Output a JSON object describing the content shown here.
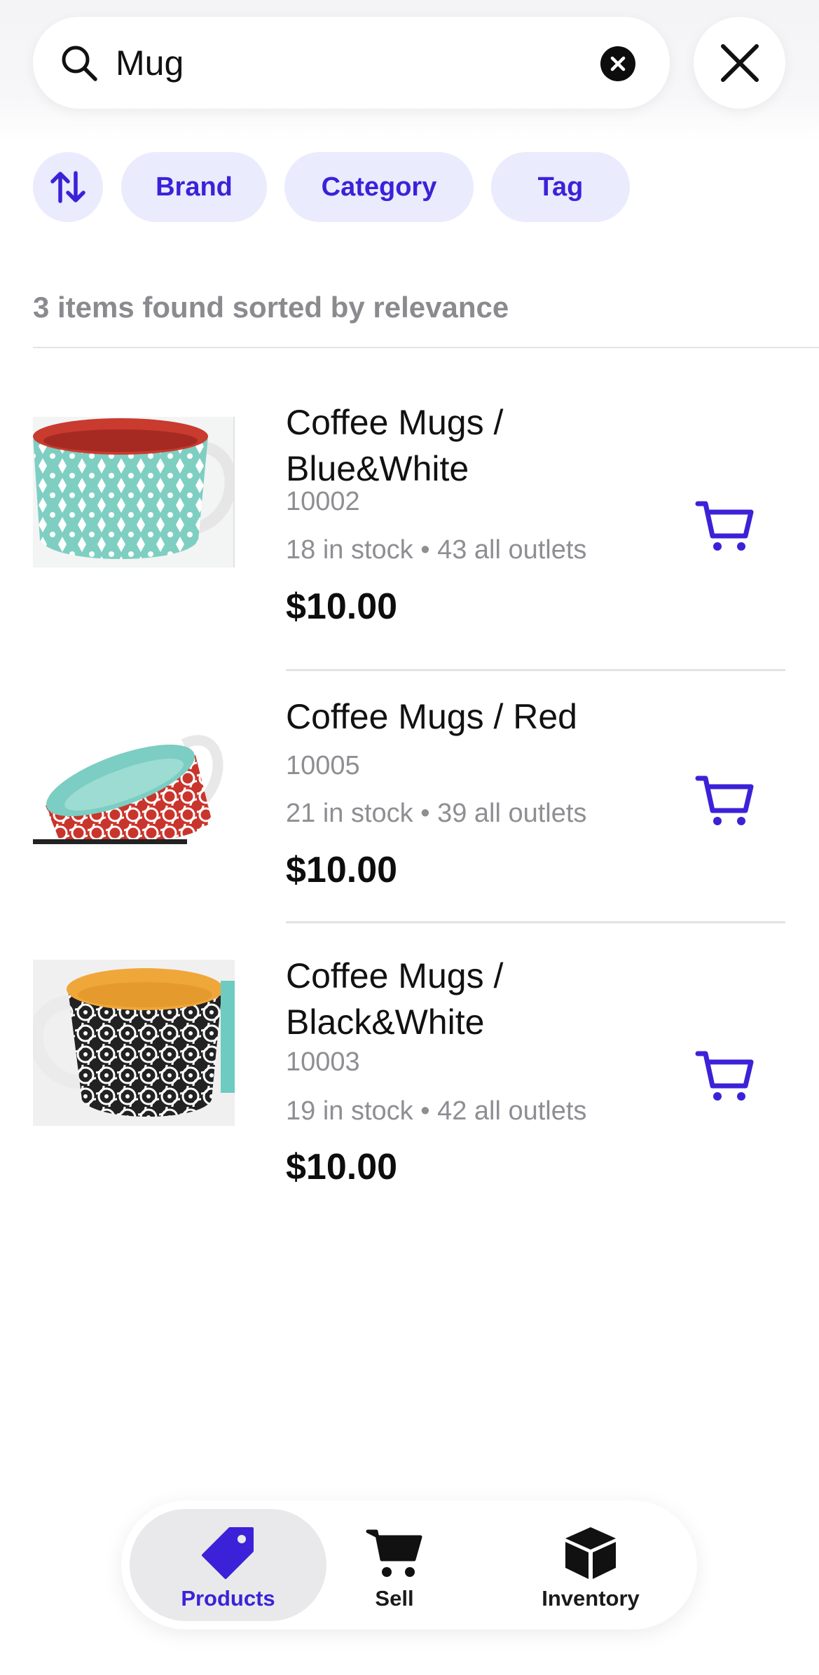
{
  "search": {
    "query": "Mug"
  },
  "filters": {
    "sort_icon": "sort-arrows-icon",
    "chips": [
      "Brand",
      "Category",
      "Tag"
    ]
  },
  "results_summary": "3 items found sorted by relevance",
  "products": [
    {
      "name": "Coffee Mugs / Blue&White",
      "sku": "10002",
      "stock": "18 in stock • 43 all outlets",
      "price": "$10.00",
      "cart_icon": "cart-icon"
    },
    {
      "name": "Coffee Mugs / Red",
      "sku": "10005",
      "stock": "21 in stock • 39 all outlets",
      "price": "$10.00",
      "cart_icon": "cart-icon"
    },
    {
      "name": "Coffee Mugs / Black&White",
      "sku": "10003",
      "stock": "19 in stock • 42 all outlets",
      "price": "$10.00",
      "cart_icon": "cart-icon"
    }
  ],
  "nav": {
    "items": [
      {
        "label": "Products",
        "icon": "tag-icon",
        "active": true
      },
      {
        "label": "Sell",
        "icon": "cart-icon",
        "active": false
      },
      {
        "label": "Inventory",
        "icon": "box-icon",
        "active": false
      }
    ]
  },
  "colors": {
    "accent": "#3b22d8",
    "chip_bg": "#eaebfd",
    "muted_text": "#8e8e93"
  }
}
